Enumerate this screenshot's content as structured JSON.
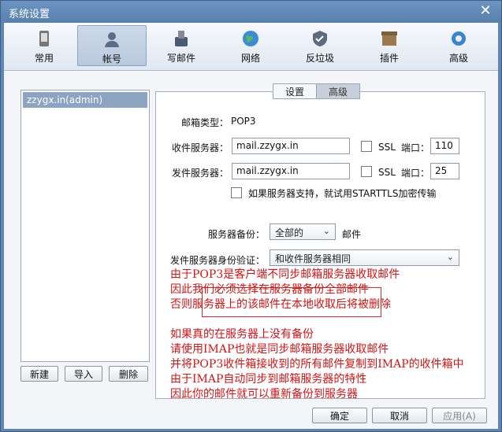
{
  "window": {
    "title": "系统设置"
  },
  "toolbar": {
    "items": [
      {
        "label": "常用",
        "icon": "phone-icon"
      },
      {
        "label": "帐号",
        "icon": "user-icon"
      },
      {
        "label": "写邮件",
        "icon": "compose-icon"
      },
      {
        "label": "网络",
        "icon": "globe-icon"
      },
      {
        "label": "反垃圾",
        "icon": "shield-icon"
      },
      {
        "label": "插件",
        "icon": "box-icon"
      },
      {
        "label": "高级",
        "icon": "gear-icon"
      }
    ]
  },
  "accounts": {
    "items": [
      "zzygx.in(admin)"
    ]
  },
  "account_buttons": {
    "new": "新建",
    "import": "导入",
    "delete": "删除"
  },
  "tabs": {
    "settings": "设置",
    "advanced": "高级"
  },
  "form": {
    "mail_type_label": "邮箱类型：",
    "mail_type_value": "POP3",
    "incoming_label": "收件服务器：",
    "incoming_value": "mail.zzygx.in",
    "outgoing_label": "发件服务器：",
    "outgoing_value": "mail.zzygx.in",
    "ssl_label": "SSL",
    "port_label": "端口：",
    "incoming_port": "110",
    "outgoing_port": "25",
    "starttls_label": "如果服务器支持，就试用STARTTLS加密传输",
    "backup_label": "服务器备份：",
    "backup_value": "全部的",
    "backup_suffix": "邮件",
    "auth_label": "发件服务器身份验证：",
    "auth_value": "和收件服务器相同"
  },
  "annotation": {
    "text": "由于POP3是客户端不同步邮箱服务器收取邮件\n因此我们必须选择在服务器备份全部邮件\n否则服务器上的该邮件在本地收取后将被删除\n\n如果真的在服务器上没有备份\n请使用IMAP也就是同步邮箱服务器收取邮件\n并将POP3收件箱接收到的所有邮件复制到IMAP的收件箱中\n由于IMAP自动同步到邮箱服务器的特性\n因此你的邮件就可以重新备份到服务器"
  },
  "footer": {
    "ok": "确定",
    "cancel": "取消",
    "apply": "应用(A)"
  },
  "colors": {
    "annotation": "#d21414",
    "highlight_box": "#d9282a",
    "titlebar": "#5f86b4"
  }
}
